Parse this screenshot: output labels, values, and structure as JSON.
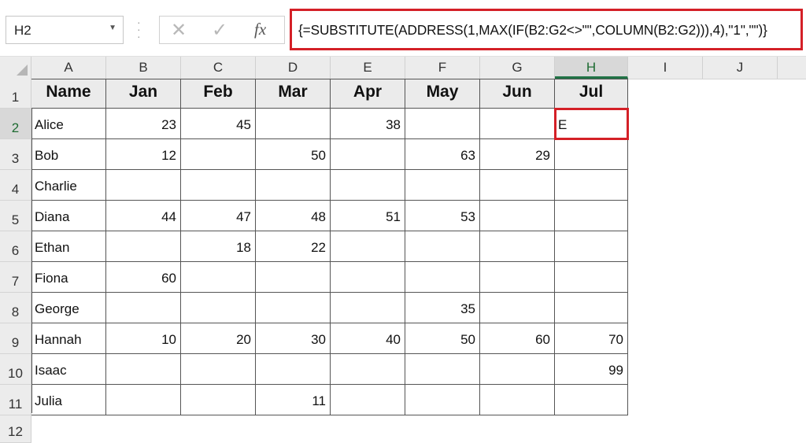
{
  "name_box": {
    "value": "H2"
  },
  "formula_bar": {
    "cancel_icon": "x-icon",
    "enter_icon": "check-icon",
    "fx_label": "fx",
    "formula": "{=SUBSTITUTE(ADDRESS(1,MAX(IF(B2:G2<>\"\",COLUMN(B2:G2))),4),\"1\",\"\")}"
  },
  "column_headers": [
    "A",
    "B",
    "C",
    "D",
    "E",
    "F",
    "G",
    "H",
    "I",
    "J"
  ],
  "row_headers": [
    "1",
    "2",
    "3",
    "4",
    "5",
    "6",
    "7",
    "8",
    "9",
    "10",
    "11",
    "12"
  ],
  "active_cell": "H2",
  "accent_color": "#217346",
  "highlight_color": "#d42027",
  "table": {
    "headers": [
      "Name",
      "Jan",
      "Feb",
      "Mar",
      "Apr",
      "May",
      "Jun",
      "Jul"
    ],
    "rows": [
      [
        "Alice",
        "23",
        "45",
        "",
        "38",
        "",
        "",
        "E"
      ],
      [
        "Bob",
        "12",
        "",
        "50",
        "",
        "63",
        "29",
        ""
      ],
      [
        "Charlie",
        "",
        "",
        "",
        "",
        "",
        "",
        ""
      ],
      [
        "Diana",
        "44",
        "47",
        "48",
        "51",
        "53",
        "",
        ""
      ],
      [
        "Ethan",
        "",
        "18",
        "22",
        "",
        "",
        "",
        ""
      ],
      [
        "Fiona",
        "60",
        "",
        "",
        "",
        "",
        "",
        ""
      ],
      [
        "George",
        "",
        "",
        "",
        "",
        "35",
        "",
        ""
      ],
      [
        "Hannah",
        "10",
        "20",
        "30",
        "40",
        "50",
        "60",
        "70"
      ],
      [
        "Isaac",
        "",
        "",
        "",
        "",
        "",
        "",
        "99"
      ],
      [
        "Julia",
        "",
        "",
        "11",
        "",
        "",
        "",
        ""
      ]
    ]
  }
}
